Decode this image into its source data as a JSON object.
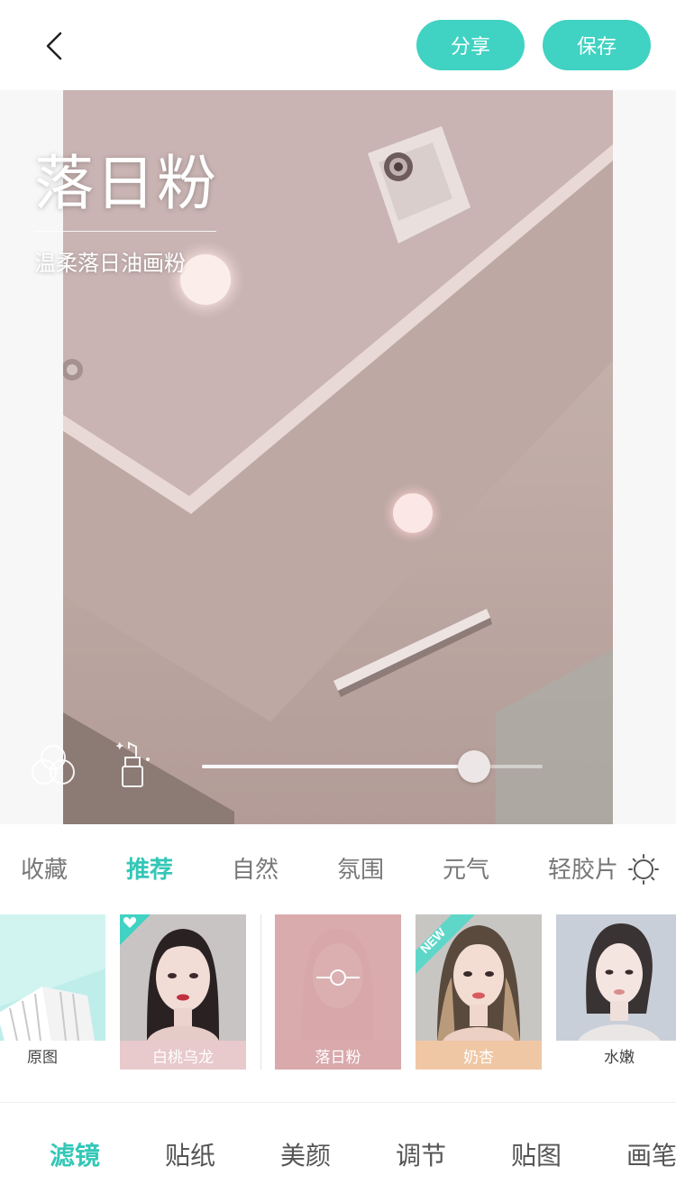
{
  "header": {
    "back_icon": "chevron-left-icon",
    "share_label": "分享",
    "save_label": "保存",
    "accent_color": "#40d2c2"
  },
  "preview": {
    "filter_name": "落日粉",
    "filter_description": "温柔落日油画粉",
    "tone_icon": "overlapping-circles-icon",
    "makeup_icon": "lipstick-sparkle-icon",
    "intensity": 0.8
  },
  "categories": {
    "items": [
      "收藏",
      "推荐",
      "自然",
      "氛围",
      "元气",
      "轻胶片"
    ],
    "active": "推荐",
    "settings_icon": "sun-gear-icon"
  },
  "filters": [
    {
      "label": "原图",
      "label_bg": "#ffffff",
      "label_color": "#444444"
    },
    {
      "label": "白桃乌龙",
      "label_bg": "#e8c9cc",
      "label_color": "#ffffff",
      "badge_icon": "heart-icon"
    },
    {
      "label": "落日粉",
      "label_bg": "#d9a9ac",
      "label_color": "#ffffff",
      "selected_icon": "slider-adjust-icon"
    },
    {
      "label": "奶杏",
      "label_bg": "#f0c7a4",
      "label_color": "#ffffff",
      "badge": "NEW"
    },
    {
      "label": "水嫩",
      "label_bg": "#ffffff",
      "label_color": "#444444"
    }
  ],
  "toolbar": {
    "items": [
      "滤镜",
      "贴纸",
      "美颜",
      "调节",
      "贴图",
      "画笔"
    ],
    "active": "滤镜"
  }
}
